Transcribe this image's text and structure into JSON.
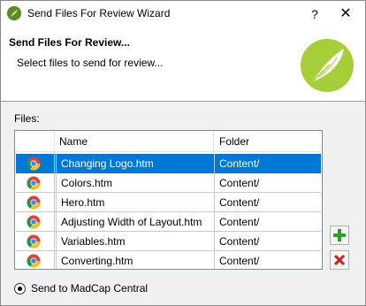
{
  "window": {
    "title": "Send Files For Review Wizard",
    "help_label": "?",
    "close_label": "✕"
  },
  "header": {
    "title": "Send Files For Review...",
    "subtitle": "Select files to send for review..."
  },
  "files_label": "Files:",
  "table": {
    "columns": [
      "Name",
      "Folder"
    ],
    "rows": [
      {
        "name": "Changing Logo.htm",
        "folder": "Content/",
        "selected": true,
        "icon": "chrome-icon"
      },
      {
        "name": "Colors.htm",
        "folder": "Content/",
        "selected": false,
        "icon": "chrome-icon"
      },
      {
        "name": "Hero.htm",
        "folder": "Content/",
        "selected": false,
        "icon": "chrome-icon"
      },
      {
        "name": "Adjusting Width of Layout.htm",
        "folder": "Content/",
        "selected": false,
        "icon": "chrome-icon"
      },
      {
        "name": "Variables.htm",
        "folder": "Content/",
        "selected": false,
        "icon": "chrome-icon"
      },
      {
        "name": "Converting.htm",
        "folder": "Content/",
        "selected": false,
        "icon": "chrome-icon"
      }
    ]
  },
  "buttons": {
    "add_icon": "plus-icon",
    "remove_icon": "x-icon"
  },
  "radio": {
    "label": "Send to MadCap Central",
    "checked": true
  },
  "colors": {
    "selection": "#0078d7",
    "brand_green": "#8dc63f",
    "add_green": "#2e9e2e",
    "remove_red": "#d02020"
  }
}
